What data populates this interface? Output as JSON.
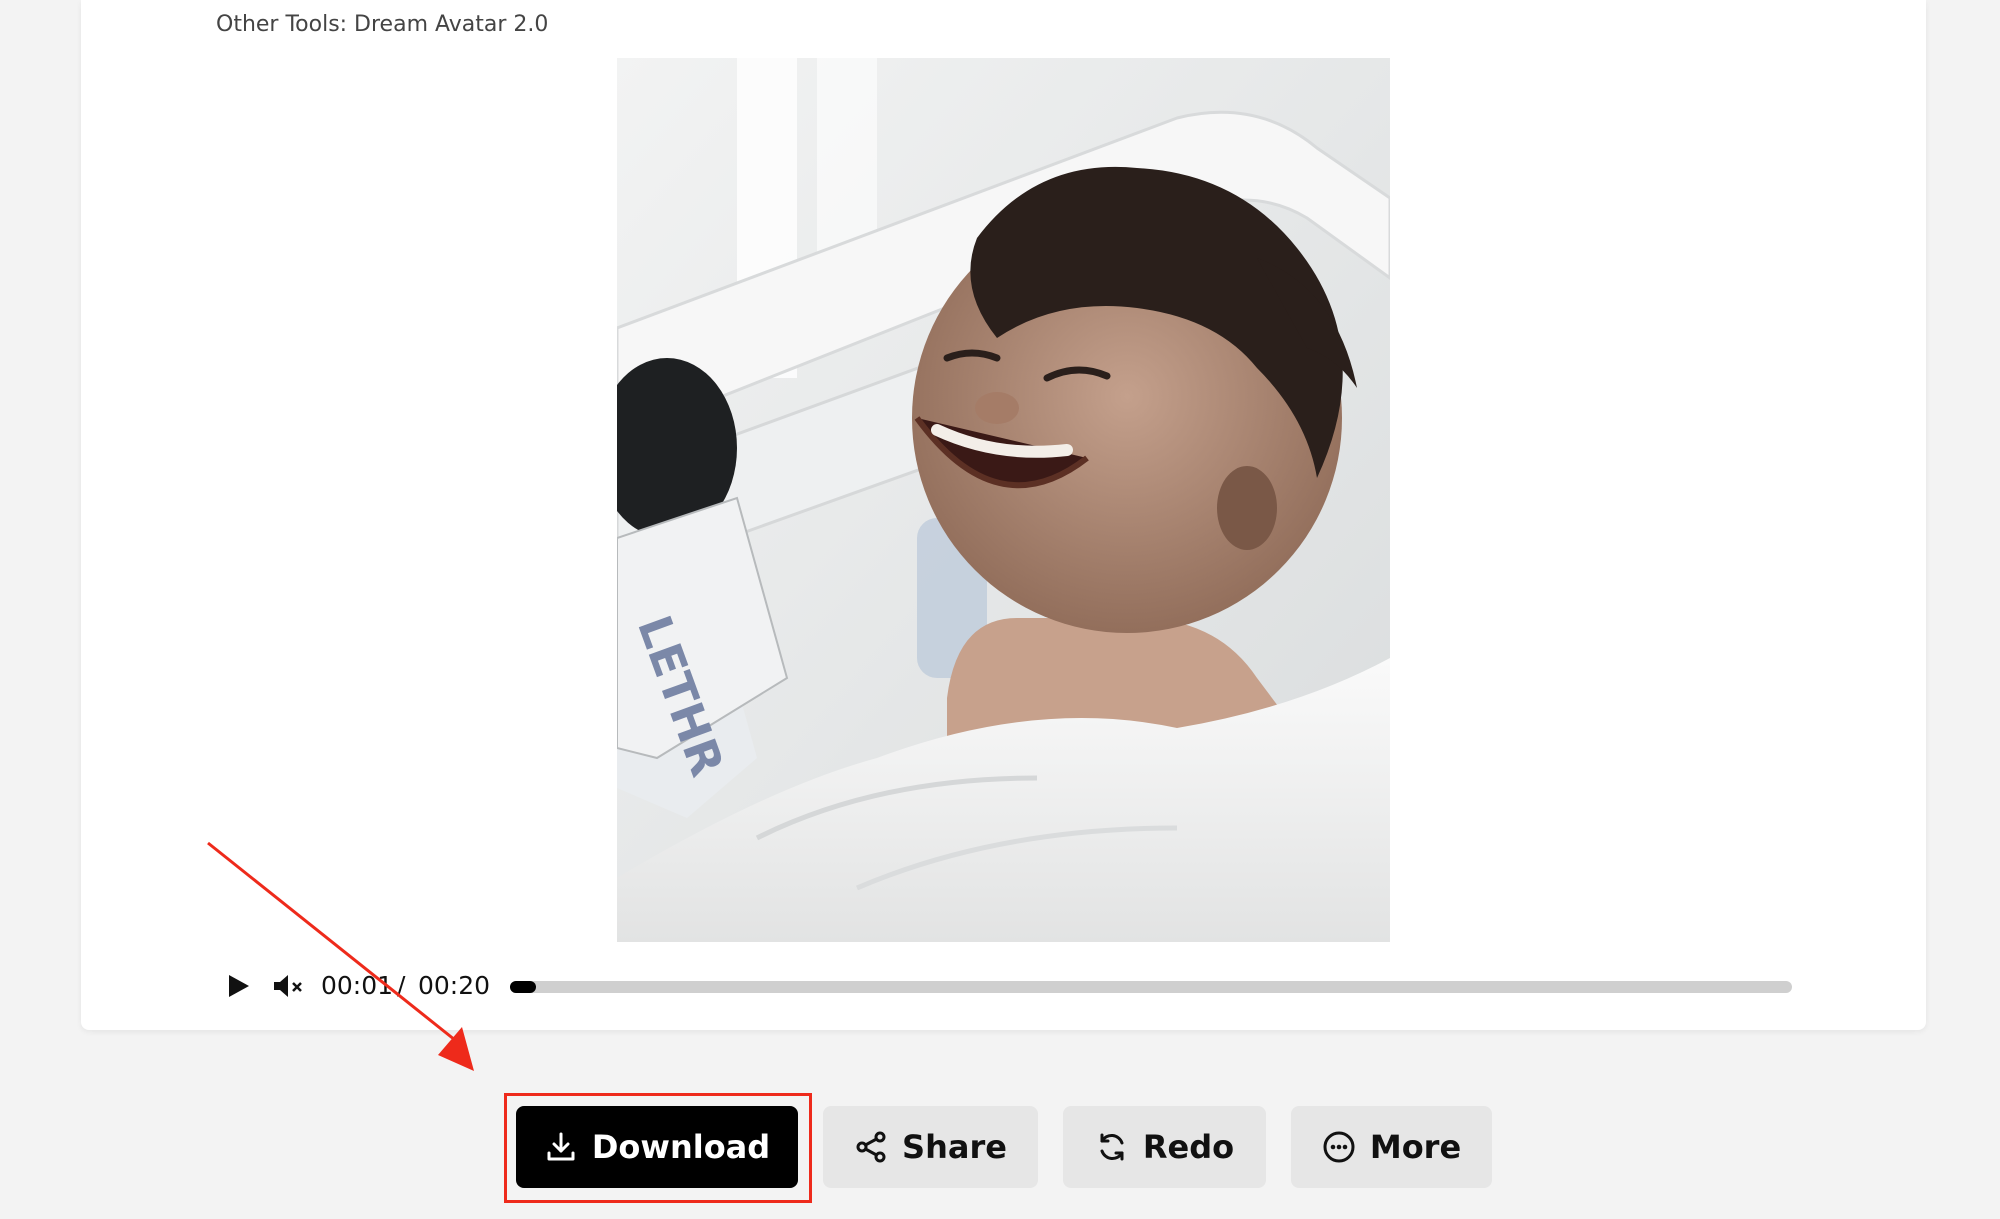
{
  "tools_label": "Other Tools: Dream Avatar 2.0",
  "player": {
    "current_time": "00:01",
    "separator": "/",
    "total_time": "00:20",
    "progress_fraction": 0.02,
    "play_icon": "play-icon",
    "mute_icon": "volume-muted-icon"
  },
  "video": {
    "mic_flag_text": "LETHR"
  },
  "actions": {
    "download_label": "Download",
    "share_label": "Share",
    "redo_label": "Redo",
    "more_label": "More"
  },
  "icons": {
    "download": "download-icon",
    "share": "share-icon",
    "redo": "redo-icon",
    "more": "more-icon"
  },
  "colors": {
    "primary_button": "#000000",
    "secondary_button": "#e6e6e6",
    "annotation": "#ee2a1b",
    "page_background": "#f3f3f3"
  }
}
